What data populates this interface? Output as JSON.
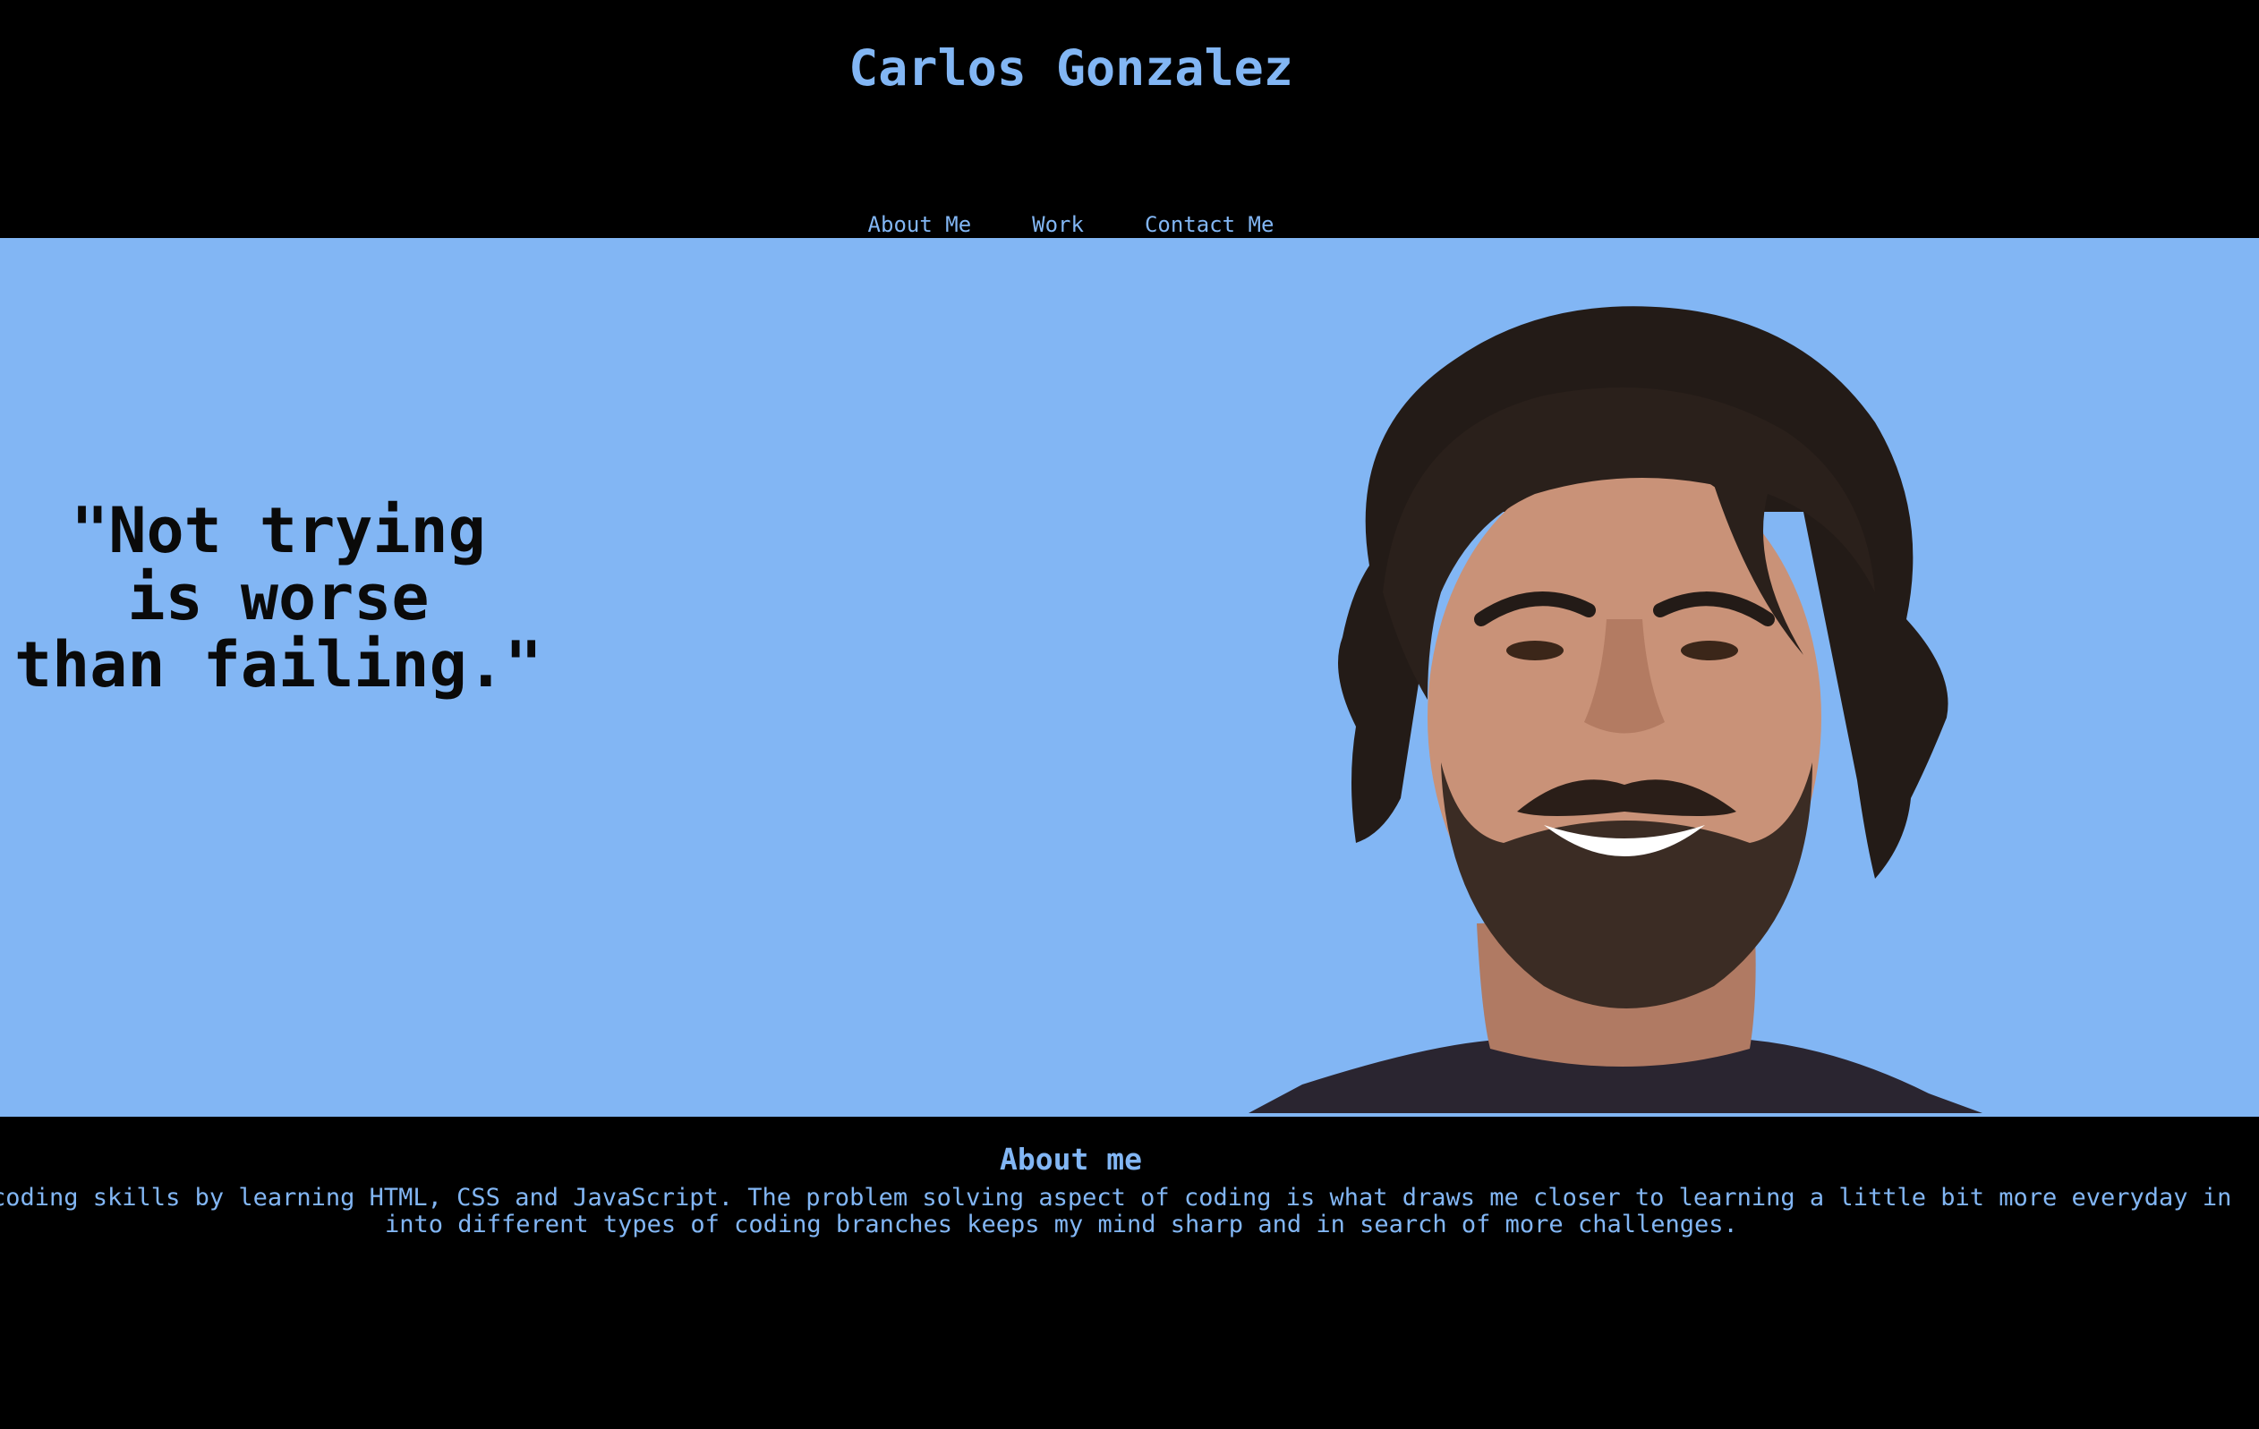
{
  "header": {
    "title": "Carlos Gonzalez",
    "nav": [
      {
        "label": "About Me"
      },
      {
        "label": "Work"
      },
      {
        "label": "Contact Me"
      }
    ]
  },
  "hero": {
    "quote_lines": [
      "\"Not trying",
      "is worse",
      "than failing.\""
    ],
    "portrait": "portrait-photo"
  },
  "about": {
    "heading": "About me",
    "text_lines": [
      "coding skills by learning HTML, CSS and JavaScript. The problem solving aspect of coding is what draws me closer to learning a little bit more everyday in",
      "into different types of coding branches keeps my mind sharp and in search of more challenges."
    ]
  },
  "colors": {
    "accent": "#82b6f4",
    "background": "#000000",
    "hero_background": "#82b6f4",
    "quote_text": "#0a0a0a"
  }
}
